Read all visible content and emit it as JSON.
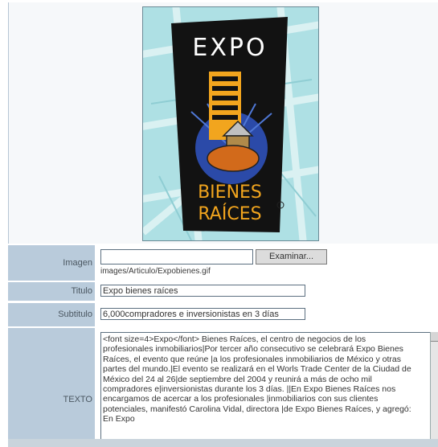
{
  "form": {
    "imagen": {
      "label": "Imagen",
      "button": "Examinar...",
      "path": "images/Articulo/Expobienes.gif"
    },
    "titulo": {
      "label": "Titulo",
      "value": "Expo bienes raíces"
    },
    "subtitulo": {
      "label": "Subtitulo",
      "value": "6,000compradores e inversionistas en 3 días"
    },
    "texto": {
      "label": "TEXTO",
      "value": "<font size=4>Expo</font> Bienes Raíces, el centro de negocios de los profesionales inmobiliarios|Por tercer año consecutivo se celebrará Expo Bienes Raíces, el evento que reúne |a los profesionales inmobiliarios de México y otras partes del mundo.|El evento se realizará en el Worls Trade Center de la Ciudad de México del 24 al 26|de septiembre del 2004 y reunirá a más de ocho mil compradores e|inversionistas durante los 3 días. ||En Expo Bienes Raíces nos encargamos de acercar a los profesionales |inmobiliarios con sus clientes potenciales, manifestó Carolina Vidal, directora |de Expo Bienes Raíces, y agregó: En Expo"
    }
  },
  "poster": {
    "top": "EXPO",
    "line1": "BIENES",
    "line2": "RAÍCES"
  },
  "colors": {
    "label_bg": "#b9cbdb",
    "poster_bg": "#aee0e4",
    "poster_orange": "#f2a51e"
  }
}
